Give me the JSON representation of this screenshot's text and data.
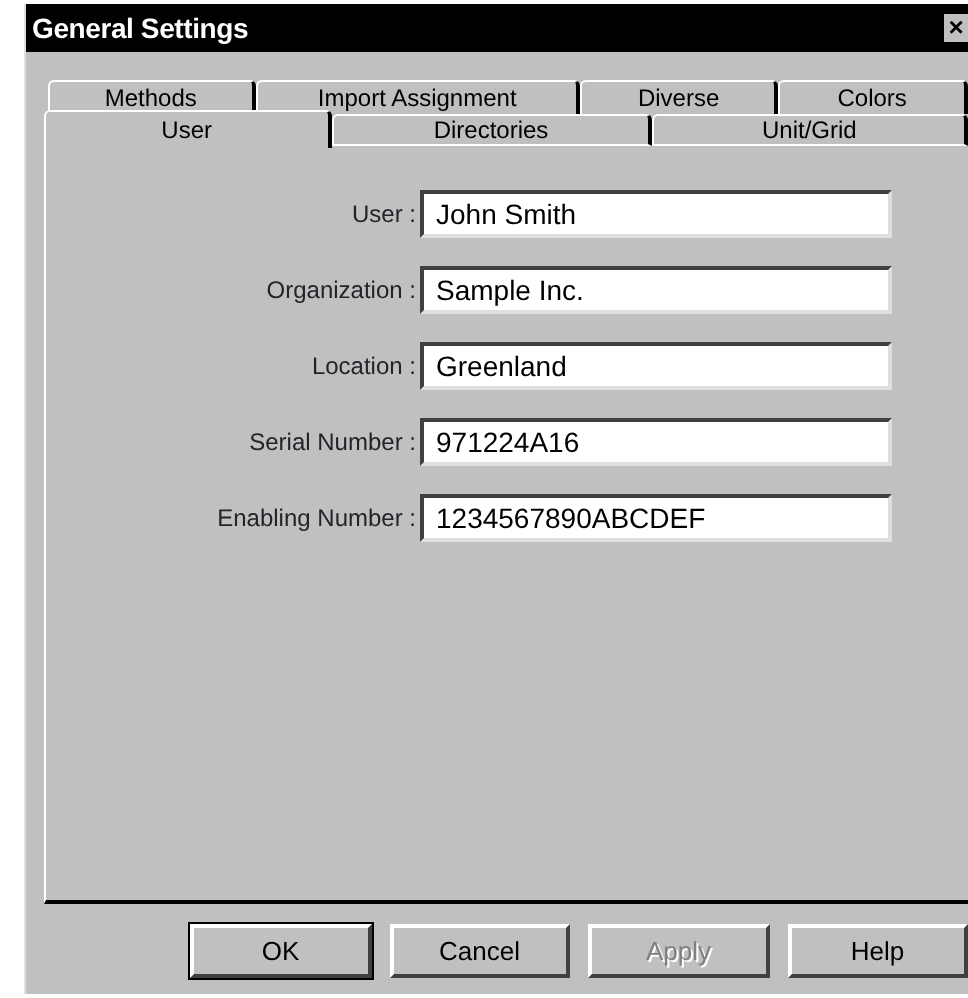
{
  "window": {
    "title": "General Settings",
    "close": "×"
  },
  "tab_rows": [
    [
      {
        "label": "Methods",
        "selected": false
      },
      {
        "label": "Import Assignment",
        "selected": false
      },
      {
        "label": "Diverse",
        "selected": false
      },
      {
        "label": "Colors",
        "selected": false
      }
    ],
    [
      {
        "label": "User",
        "selected": true
      },
      {
        "label": "Directories",
        "selected": false
      },
      {
        "label": "Unit/Grid",
        "selected": false
      }
    ]
  ],
  "fields": [
    {
      "label": "User :",
      "value": "John Smith"
    },
    {
      "label": "Organization :",
      "value": "Sample Inc."
    },
    {
      "label": "Location :",
      "value": "Greenland"
    },
    {
      "label": "Serial Number :",
      "value": "971224A16"
    },
    {
      "label": "Enabling Number :",
      "value": "1234567890ABCDEF"
    }
  ],
  "buttons": [
    {
      "label": "OK",
      "default": true,
      "disabled": false
    },
    {
      "label": "Cancel",
      "default": false,
      "disabled": false
    },
    {
      "label": "Apply",
      "default": false,
      "disabled": true
    },
    {
      "label": "Help",
      "default": false,
      "disabled": false
    }
  ]
}
